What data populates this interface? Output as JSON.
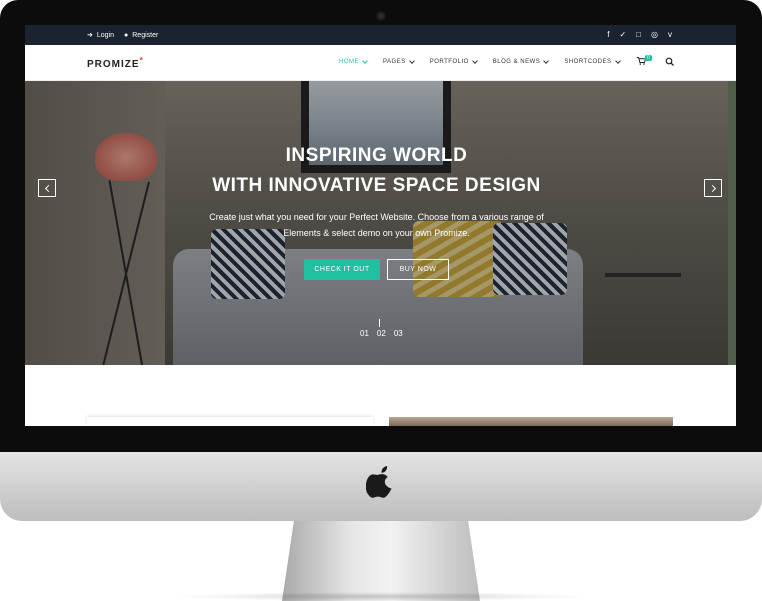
{
  "topbar": {
    "login": "Login",
    "register": "Register",
    "social": [
      "facebook-icon",
      "twitter-icon",
      "instagram-icon",
      "dribbble-icon",
      "vimeo-icon"
    ]
  },
  "brand": {
    "name": "PROMIZE",
    "mark": "*"
  },
  "nav": {
    "items": [
      {
        "label": "HOME",
        "active": true
      },
      {
        "label": "PAGES"
      },
      {
        "label": "PORTFOLIO"
      },
      {
        "label": "BLOG & NEWS"
      },
      {
        "label": "SHORTCODES"
      }
    ],
    "cart_count": "0"
  },
  "hero": {
    "title_line1": "INSPIRING WORLD",
    "title_line2": "WITH INNOVATIVE SPACE DESIGN",
    "subtitle_line1": "Create just what you need for your Perfect Website. Choose from a various range of",
    "subtitle_line2": "Elements & select demo on your own Promize.",
    "primary_button": "CHECK IT OUT",
    "secondary_button": "BUY NOW",
    "slides": [
      "01",
      "02",
      "03"
    ],
    "active_slide": "02"
  },
  "colors": {
    "accent": "#1fbfa0",
    "topbar": "#1b2330",
    "logo_star": "#e23b3b"
  }
}
